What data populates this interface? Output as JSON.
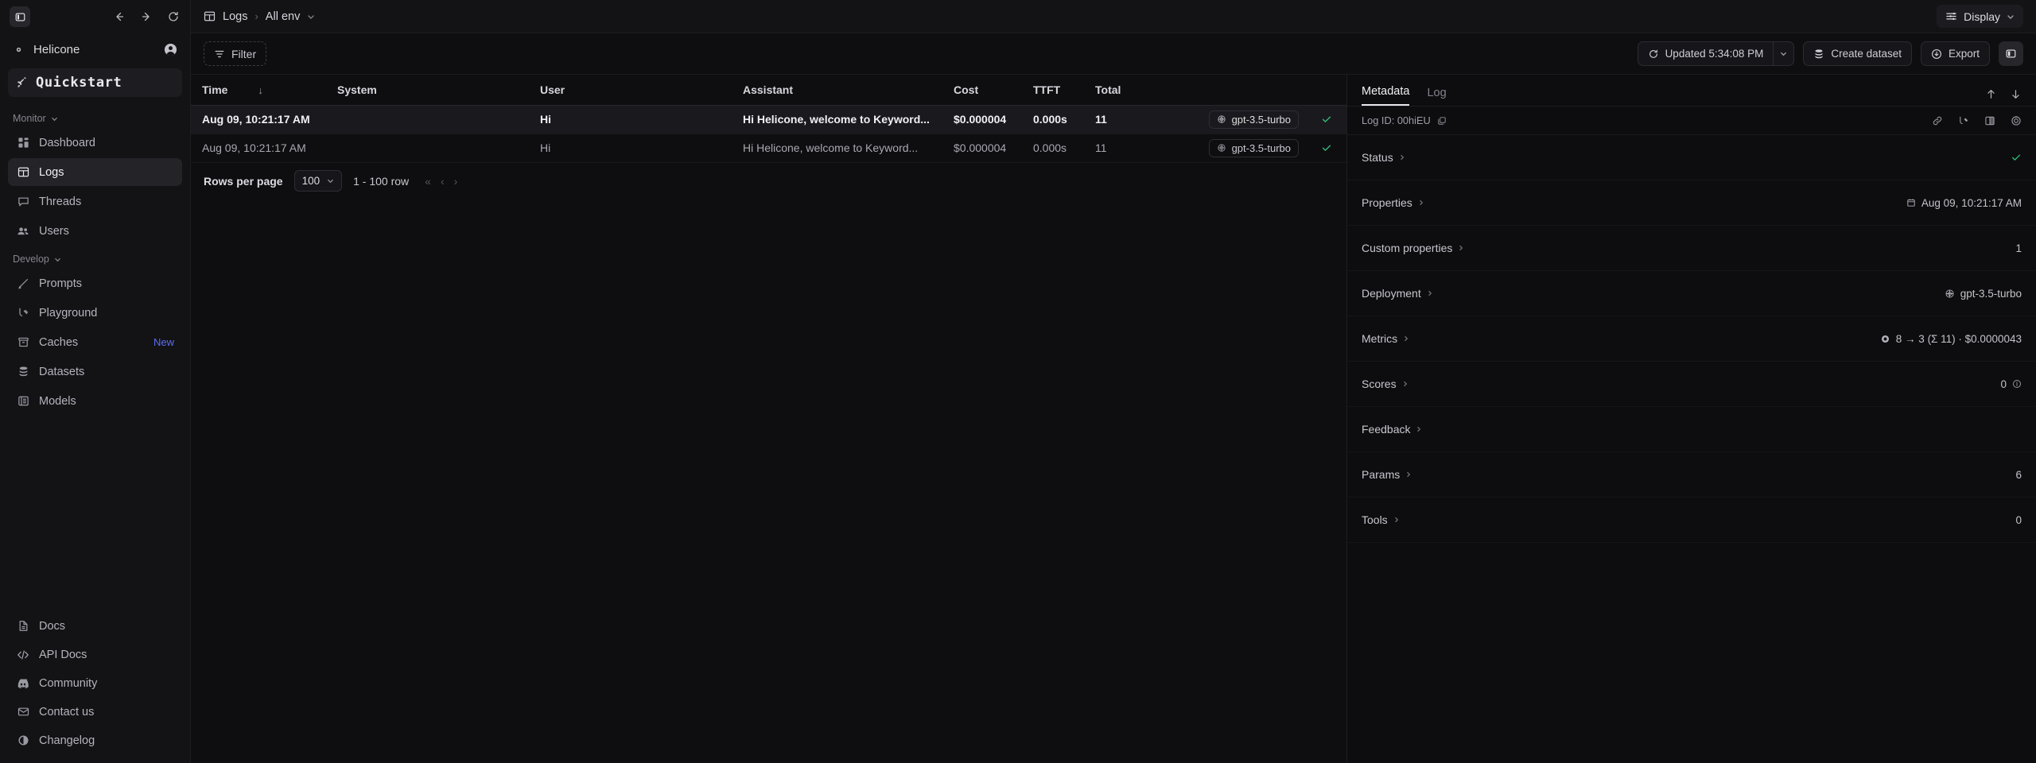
{
  "sidebar": {
    "panel_toggle_icon": "panel-left-icon",
    "nav": {
      "back_icon": "arrow-left-icon",
      "forward_icon": "arrow-right-icon",
      "reload_icon": "reload-icon"
    },
    "org": {
      "name": "Helicone",
      "settings_icon": "gear-icon",
      "avatar_icon": "user-circle-icon"
    },
    "quickstart": {
      "label": "Quickstart",
      "icon": "rocket-icon"
    },
    "groups": [
      {
        "label": "Monitor",
        "caret_icon": "chevron-down-icon",
        "items": [
          {
            "label": "Dashboard",
            "icon": "dashboard-icon",
            "active": false,
            "badge": ""
          },
          {
            "label": "Logs",
            "icon": "table-icon",
            "active": true,
            "badge": ""
          },
          {
            "label": "Threads",
            "icon": "message-icon",
            "active": false,
            "badge": ""
          },
          {
            "label": "Users",
            "icon": "users-icon",
            "active": false,
            "badge": ""
          }
        ]
      },
      {
        "label": "Develop",
        "caret_icon": "chevron-down-icon",
        "items": [
          {
            "label": "Prompts",
            "icon": "pencil-icon",
            "active": false,
            "badge": ""
          },
          {
            "label": "Playground",
            "icon": "playground-icon",
            "active": false,
            "badge": ""
          },
          {
            "label": "Caches",
            "icon": "archive-icon",
            "active": false,
            "badge": "New"
          },
          {
            "label": "Datasets",
            "icon": "database-icon",
            "active": false,
            "badge": ""
          },
          {
            "label": "Models",
            "icon": "list-icon",
            "active": false,
            "badge": ""
          }
        ]
      }
    ],
    "footer_items": [
      {
        "label": "Docs",
        "icon": "document-icon"
      },
      {
        "label": "API Docs",
        "icon": "code-icon"
      },
      {
        "label": "Community",
        "icon": "discord-icon"
      },
      {
        "label": "Contact us",
        "icon": "mail-icon"
      },
      {
        "label": "Changelog",
        "icon": "changelog-icon"
      }
    ],
    "accent_new": "#5b6ef5"
  },
  "topbar": {
    "breadcrumb": {
      "icon": "table-icon",
      "root": "Logs",
      "separator": "›",
      "env": "All env",
      "caret_icon": "chevron-down-icon"
    },
    "display": {
      "label": "Display",
      "icon": "sliders-icon",
      "caret_icon": "chevron-down-icon"
    }
  },
  "toolbar": {
    "filter": {
      "label": "Filter",
      "icon": "filter-icon"
    },
    "updated": {
      "label": "Updated 5:34:08 PM",
      "icon": "refresh-icon",
      "caret_icon": "chevron-down-icon"
    },
    "create_dataset": {
      "label": "Create dataset",
      "icon": "database-icon"
    },
    "export": {
      "label": "Export",
      "icon": "download-circle-icon"
    },
    "panel_toggle_icon": "panel-right-icon"
  },
  "table": {
    "columns": [
      "Time",
      "System",
      "User",
      "Assistant",
      "Cost",
      "TTFT",
      "Total"
    ],
    "sort_column": "Time",
    "sort_icon": "arrow-down-icon",
    "rows": [
      {
        "time": "Aug 09, 10:21:17 AM",
        "system": "",
        "user": "Hi",
        "assistant": "Hi Helicone, welcome to Keyword...",
        "cost": "$0.000004",
        "ttft": "0.000s",
        "total": "11",
        "model": "gpt-3.5-turbo",
        "model_icon": "openai-icon",
        "status_icon": "check-icon",
        "selected": true
      },
      {
        "time": "Aug 09, 10:21:17 AM",
        "system": "",
        "user": "Hi",
        "assistant": "Hi Helicone, welcome to Keyword...",
        "cost": "$0.000004",
        "ttft": "0.000s",
        "total": "11",
        "model": "gpt-3.5-turbo",
        "model_icon": "openai-icon",
        "status_icon": "check-icon",
        "selected": false
      }
    ],
    "status_color": "#34b878"
  },
  "pager": {
    "rows_per_page_label": "Rows per page",
    "rows_per_page_value": "100",
    "caret_icon": "chevron-down-icon",
    "range": "1 - 100 row",
    "first_icon": "«",
    "prev_icon": "‹",
    "next_icon": "›"
  },
  "meta": {
    "tabs": [
      {
        "label": "Metadata",
        "active": true
      },
      {
        "label": "Log",
        "active": false
      }
    ],
    "nav_up_icon": "arrow-up-icon",
    "nav_down_icon": "arrow-down-icon",
    "log_id_label": "Log ID: 00hiEU",
    "copy_icon": "copy-icon",
    "action_icons": [
      "link-icon",
      "playground-icon",
      "compare-icon",
      "target-icon"
    ],
    "rows": [
      {
        "label": "Status",
        "caret_icon": "chevron-right-icon",
        "value": "",
        "value_icon": "check-icon",
        "value_color": "#34b878"
      },
      {
        "label": "Properties",
        "caret_icon": "chevron-right-icon",
        "value": "Aug 09, 10:21:17 AM",
        "value_icon": "calendar-icon",
        "value_color": ""
      },
      {
        "label": "Custom properties",
        "caret_icon": "chevron-right-icon",
        "value": "1",
        "value_icon": "",
        "value_color": ""
      },
      {
        "label": "Deployment",
        "caret_icon": "chevron-right-icon",
        "value": "gpt-3.5-turbo",
        "value_icon": "openai-icon",
        "value_color": ""
      },
      {
        "label": "Metrics",
        "caret_icon": "chevron-right-icon",
        "value": "8 → 3 (Σ 11) · $0.0000043",
        "value_icon": "token-icon",
        "value_color": ""
      },
      {
        "label": "Scores",
        "caret_icon": "chevron-right-icon",
        "value": "0",
        "value_icon": "",
        "value_suffix_icon": "info-icon",
        "value_color": ""
      },
      {
        "label": "Feedback",
        "caret_icon": "chevron-right-icon",
        "value": "",
        "value_icon": "",
        "value_color": ""
      },
      {
        "label": "Params",
        "caret_icon": "chevron-right-icon",
        "value": "6",
        "value_icon": "",
        "value_color": ""
      },
      {
        "label": "Tools",
        "caret_icon": "chevron-right-icon",
        "value": "0",
        "value_icon": "",
        "value_color": ""
      }
    ]
  }
}
